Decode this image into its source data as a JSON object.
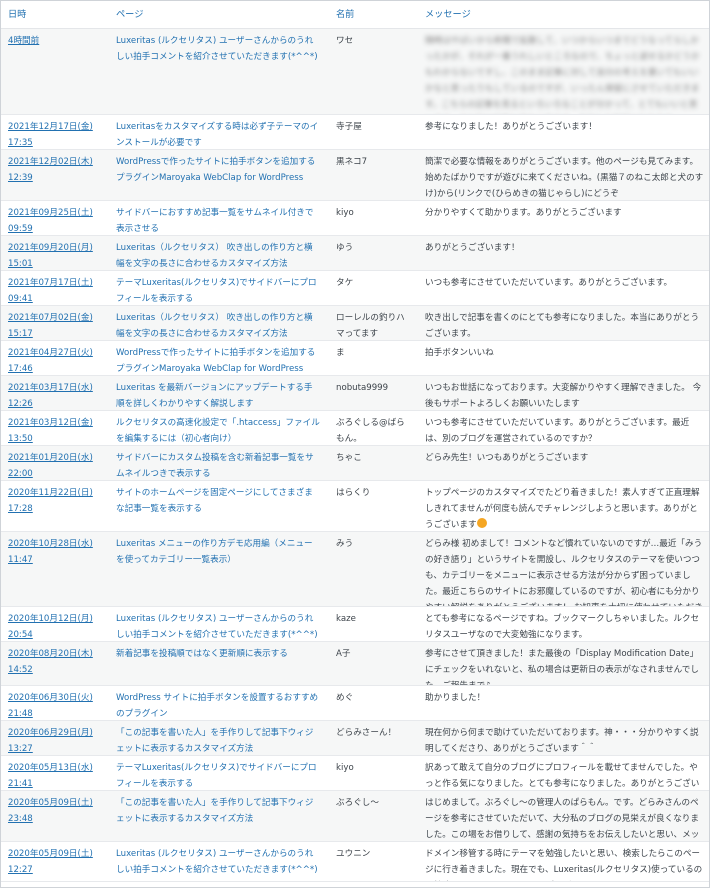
{
  "headers": {
    "date": "日時",
    "page": "ページ",
    "name": "名前",
    "message": "メッセージ"
  },
  "rows": [
    {
      "date": "4時間前",
      "page": "Luxeritas (ルクセリタス) ユーザーさんからのうれしい拍手コメントを紹介させていただきます(*^^*)",
      "name": "ワセ",
      "message": "随時はやばいから新聞で拡散して、いつからいつまでどうなってらしかったかが、それが一番うれしいところなので、ちょっと返せるかどうかもわからないですし、このまま記事に対して自分の考えを書いてもいいかなと思ったりもしているのですが、いったん保留にさせていただきます。こちらの記事を見るといろいろなことが分かって、とてもいいと思います。また別の記事も読みに来ます。今後もお世話になります。",
      "blurred": true
    },
    {
      "date": "2021年12月17日(金) 17:35",
      "page": "Luxeritasをカスタマイズする時は必ず子テーマのインストールが必要です",
      "name": "寺子屋",
      "message": "参考になりました！ありがとうございます！"
    },
    {
      "date": "2021年12月02日(木) 12:39",
      "page": "WordPressで作ったサイトに拍手ボタンを追加するプラグインMaroyaka WebClap for WordPress",
      "name": "黒ネコ7",
      "message": "簡潔で必要な情報をありがとうございます。他のページも見てみます。 始めたばかりですが遊びに来てくださいね。(黒猫７のねこ太郎と犬のすけ)から(リンクで(ひらめきの猫じゃらし)にどうぞ"
    },
    {
      "date": "2021年09月25日(土) 09:59",
      "page": "サイドバーにおすすめ記事一覧をサムネイル付きで表示させる",
      "name": "kiyo",
      "message": "分かりやすくて助かります。ありがとうございます"
    },
    {
      "date": "2021年09月20日(月) 15:01",
      "page": "Luxeritas（ルクセリタス） 吹き出しの作り方と横幅を文字の長さに合わせるカスタマイズ方法",
      "name": "ゆう",
      "message": "ありがとうございます！"
    },
    {
      "date": "2021年07月17日(土) 09:41",
      "page": "テーマLuxeritas(ルクセリタス)でサイドバーにプロフィールを表示する",
      "name": "タケ",
      "message": "いつも参考にさせていただいています。ありがとうございます。"
    },
    {
      "date": "2021年07月02日(金) 15:17",
      "page": "Luxeritas（ルクセリタス） 吹き出しの作り方と横幅を文字の長さに合わせるカスタマイズ方法",
      "name": "ローレルの釣りハマってます",
      "message": "吹き出しで記事を書くのにとても参考になりました。本当にありがとうございます。"
    },
    {
      "date": "2021年04月27日(火) 17:46",
      "page": "WordPressで作ったサイトに拍手ボタンを追加するプラグインMaroyaka WebClap for WordPress",
      "name": "ま",
      "message": "拍手ボタンいいね"
    },
    {
      "date": "2021年03月17日(水) 12:26",
      "page": "Luxeritas を最新バージョンにアップデートする手順を詳しくわかりやすく解説します",
      "name": "nobuta9999",
      "message": "いつもお世話になっております。大変解かりやすく理解できました。 今後もサポートよろしくお願いいたします"
    },
    {
      "date": "2021年03月12日(金) 13:50",
      "page": "ルクセリタスの高速化設定で「.htaccess」ファイルを編集するには（初心者向け）",
      "name": "ぶろぐしる@ばらもん。",
      "message": "いつも参考にさせていただいています。ありがとうございます。最近は、別のブログを運営されているのですか？"
    },
    {
      "date": "2021年01月20日(水) 22:00",
      "page": "サイドバーにカスタム投稿を含む新着記事一覧をサムネイルつきで表示する",
      "name": "ちゃこ",
      "message": "どらみ先生！いつもありがとうございます"
    },
    {
      "date": "2020年11月22日(日) 17:28",
      "page": "サイトのホームページを固定ページにしてさまざまな記事一覧を表示する",
      "name": "はらくり",
      "message": "トップページのカスタマイズでたどり着きました！素人すぎて正直理解しきれてませんが何度も読んでチャレンジしようと思います。ありがとうございます",
      "emoji": true
    },
    {
      "date": "2020年10月28日(水) 11:47",
      "page": "Luxeritas メニューの作り方デモ応用編（メニューを使ってカテゴリー一覧表示）",
      "name": "みう",
      "message": "どらみ様 初めまして！コメントなど慣れていないのですが…最近「みうの好き語り」というサイトを開設し、ルクセリタスのテーマを使いつつも、カテゴリーをメニューに表示させる方法が分からず困っていました。最近こちらのサイトにお邪魔しているのですが、初心者にも分かりやすい解説をありがとうございます！ お知恵を大切に使わせていただきます(*^^*)"
    },
    {
      "date": "2020年10月12日(月) 20:54",
      "page": "Luxeritas (ルクセリタス) ユーザーさんからのうれしい拍手コメントを紹介させていただきます(*^^*)",
      "name": "kaze",
      "message": "とても参考になるページですね。ブックマークしちゃいました。ルクセリタスユーザなので大変勉強になります。"
    },
    {
      "date": "2020年08月20日(木) 14:52",
      "page": "新着記事を投稿順ではなく更新順に表示する",
      "name": "A子",
      "message": "参考にさせて頂きました！また最後の「Display Modification Date」にチェックをいれないと、私の場合は更新日の表示がなされませんでした。ご報告まで♪"
    },
    {
      "date": "2020年06月30日(火) 21:48",
      "page": "WordPress サイトに拍手ボタンを設置するおすすめのプラグイン",
      "name": "めぐ",
      "message": "助かりました！"
    },
    {
      "date": "2020年06月29日(月) 13:27",
      "page": "「この記事を書いた人」を手作りして記事下ウィジェットに表示するカスタマイズ方法",
      "name": "どらみさーん！",
      "message": "現在何から何まで助けていただいております。神・・・分かりやすく説明してくださり、ありがとうございます＾＾"
    },
    {
      "date": "2020年05月13日(水) 21:41",
      "page": "テーマLuxeritas(ルクセリタス)でサイドバーにプロフィールを表示する",
      "name": "kiyo",
      "message": "訳あって敢えて自分のブログにプロフィールを載せてませんでした。やっと作る気になりました。とても参考になりました。ありがとうございます。"
    },
    {
      "date": "2020年05月09日(土) 23:48",
      "page": "「この記事を書いた人」を手作りして記事下ウィジェットに表示するカスタマイズ方法",
      "name": "ぶろぐし～",
      "message": "はじめまして。ぶろぐし～の管理人のぱらもん。です。どらみさんのページを参考にさせていただいて、大分私のブログの見栄えが良くなりました。この場をお借りして、感謝の気持ちをお伝えしたいと思い、メッセージをお送りします。ありがとうございました。"
    },
    {
      "date": "2020年05月09日(土) 12:27",
      "page": "Luxeritas (ルクセリタス) ユーザーさんからのうれしい拍手コメントを紹介させていただきます(*^^*)",
      "name": "ユウニン",
      "message": "ドメイン移管する時にテーマを勉強したいと思い、検索したらこのページに行き着きました。現在でも、Luxeritas(ルクセリタス)使っているので勉強になります…これからもがんばってください…"
    }
  ]
}
